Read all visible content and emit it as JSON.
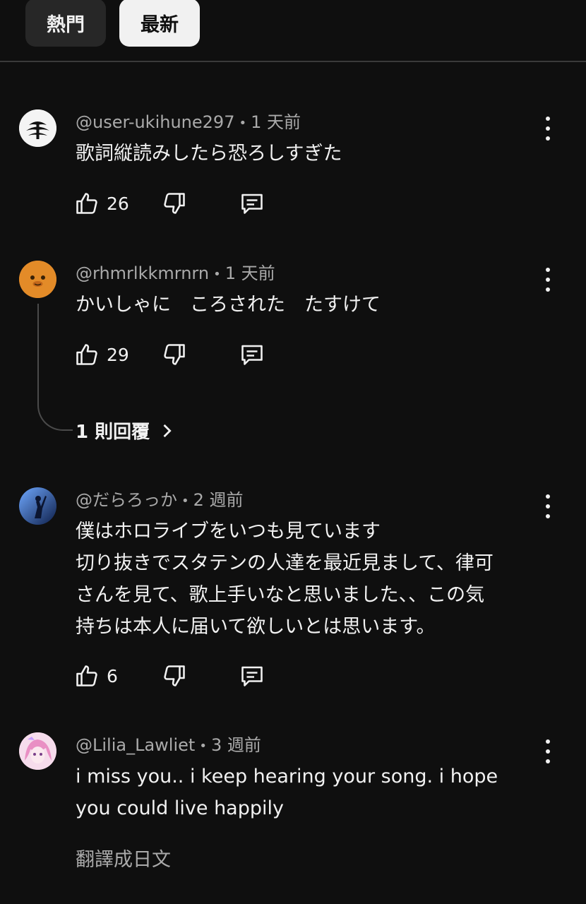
{
  "tabs": {
    "hot": "熱門",
    "new": "最新"
  },
  "comments": [
    {
      "user": "@user-ukihune297",
      "time": "1 天前",
      "text": [
        "歌詞縦読みしたら恐ろしすぎた"
      ],
      "likes": "26"
    },
    {
      "user": "@rhmrlkkmrnrn",
      "time": "1 天前",
      "text": [
        "かいしゃに　ころされた　たすけて"
      ],
      "likes": "29",
      "replies_label": "1 則回覆"
    },
    {
      "user": "@だらろっか",
      "time": "2 週前",
      "text": [
        "僕はホロライブをいつも見ています",
        "切り抜きでスタテンの人達を最近見まして、律可",
        "さんを見て、歌上手いなと思いました、、この気",
        "持ちは本人に届いて欲しいとは思います。"
      ],
      "likes": "6"
    },
    {
      "user": "@Lilia_Lawliet",
      "time": "3 週前",
      "text": [
        "i miss you.. i keep hearing your song. i hope",
        "you could live happily"
      ],
      "translate": "翻譯成日文"
    }
  ],
  "colors": {
    "background": "#0f0f0f",
    "chip_active": "#f1f1f1",
    "chip_inactive": "#272727",
    "secondary_text": "#aaaaaa"
  }
}
